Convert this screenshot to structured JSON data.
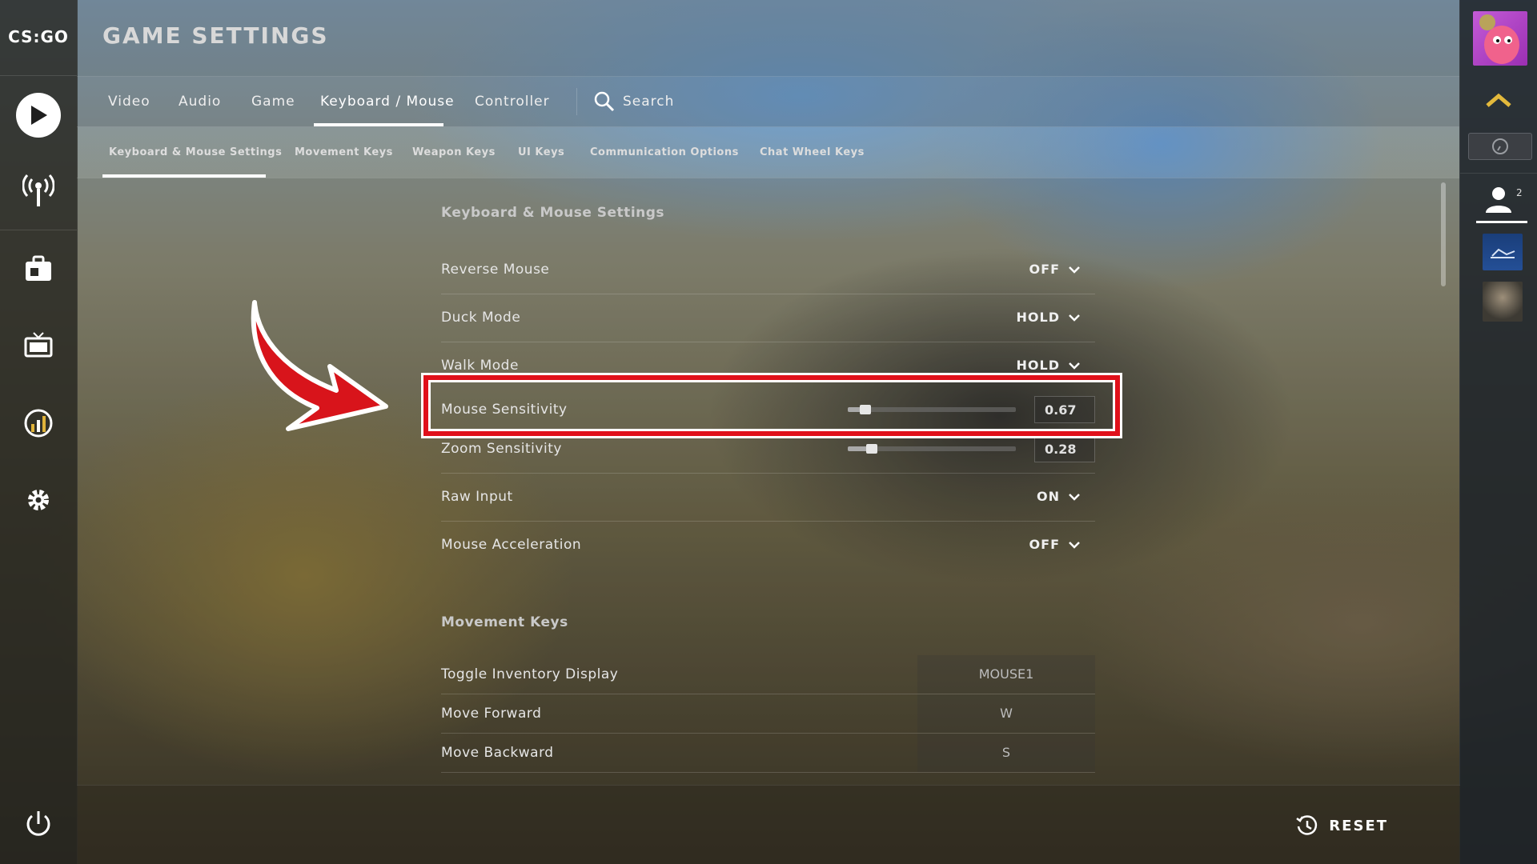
{
  "app": {
    "logo_text": "CS:GO",
    "title": "GAME SETTINGS"
  },
  "tabs": [
    {
      "label": "Video"
    },
    {
      "label": "Audio"
    },
    {
      "label": "Game"
    },
    {
      "label": "Keyboard / Mouse",
      "active": true
    },
    {
      "label": "Controller"
    }
  ],
  "search": {
    "label": "Search"
  },
  "subtabs": [
    {
      "label": "Keyboard & Mouse Settings",
      "active": true
    },
    {
      "label": "Movement Keys"
    },
    {
      "label": "Weapon Keys"
    },
    {
      "label": "UI Keys"
    },
    {
      "label": "Communication Options"
    },
    {
      "label": "Chat Wheel Keys"
    }
  ],
  "keyboard_mouse": {
    "section_title": "Keyboard & Mouse Settings",
    "reverse_mouse": {
      "label": "Reverse Mouse",
      "value": "OFF"
    },
    "duck_mode": {
      "label": "Duck Mode",
      "value": "HOLD"
    },
    "walk_mode": {
      "label": "Walk Mode",
      "value": "HOLD"
    },
    "mouse_sensitivity": {
      "label": "Mouse Sensitivity",
      "value": "0.67",
      "level": 0.08
    },
    "zoom_sensitivity": {
      "label": "Zoom Sensitivity",
      "value": "0.28",
      "level": 0.12
    },
    "raw_input": {
      "label": "Raw Input",
      "value": "ON"
    },
    "mouse_acceleration": {
      "label": "Mouse Acceleration",
      "value": "OFF"
    }
  },
  "movement_keys": {
    "section_title": "Movement Keys",
    "rows": [
      {
        "label": "Toggle Inventory Display",
        "key": "MOUSE1"
      },
      {
        "label": "Move Forward",
        "key": "W"
      },
      {
        "label": "Move Backward",
        "key": "S"
      }
    ]
  },
  "right_panel": {
    "friends_count": "2"
  },
  "footer": {
    "reset_label": "RESET"
  },
  "colors": {
    "highlight": "#e0101a",
    "active_underline": "#ffffff"
  }
}
